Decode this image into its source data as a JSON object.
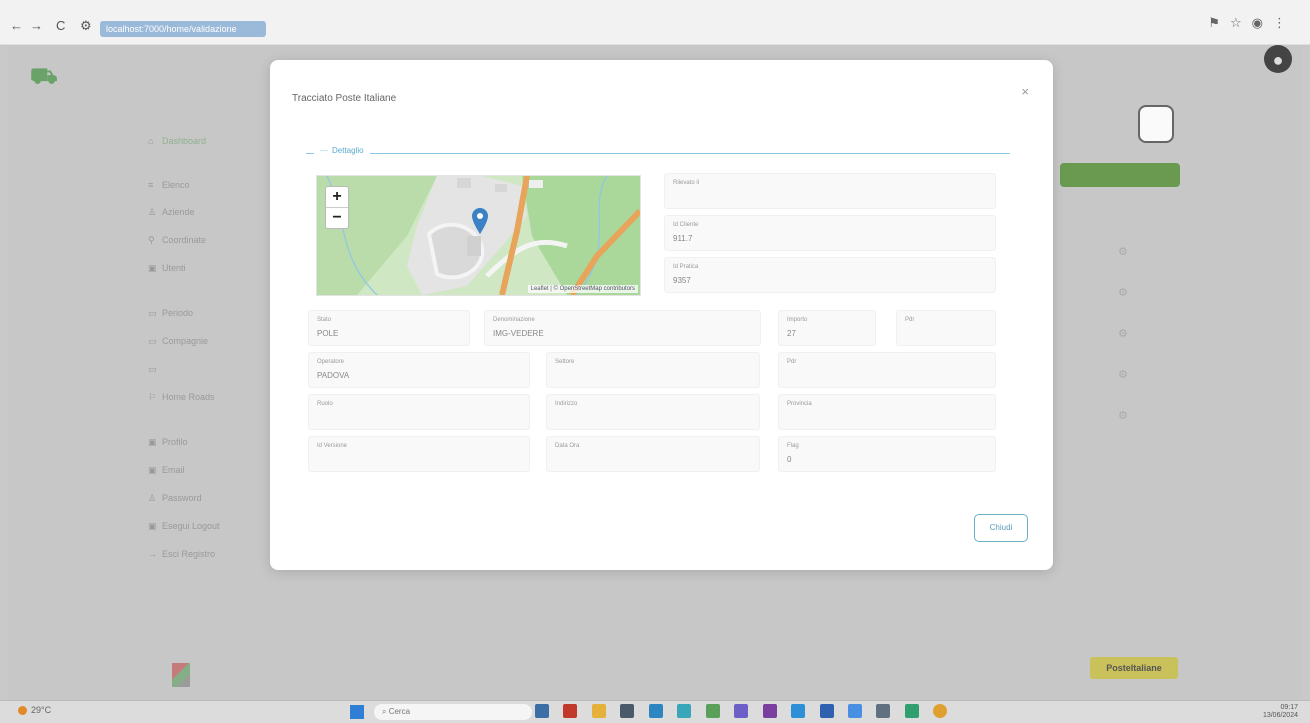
{
  "browser": {
    "url": "localhost:7000/home/validazione",
    "back": "←",
    "forward": "→",
    "reload": "C"
  },
  "app": {
    "logo_sub": "",
    "user_label": "",
    "green_button": "",
    "poste_button": "PosteItaliane",
    "sidebar": {
      "sections": [
        {
          "title": "",
          "items": [
            {
              "icon": "⌂",
              "label": "Dashboard"
            }
          ]
        },
        {
          "title": "",
          "items": [
            {
              "icon": "≡",
              "label": "Elenco"
            },
            {
              "icon": "♙",
              "label": "Aziende"
            },
            {
              "icon": "⚲",
              "label": "Coordinate"
            },
            {
              "icon": "▣",
              "label": "Utenti"
            }
          ]
        },
        {
          "title": "",
          "items": [
            {
              "icon": "▭",
              "label": "Periodo"
            },
            {
              "icon": "▭",
              "label": "Compagnie"
            },
            {
              "icon": "▭",
              "label": ""
            },
            {
              "icon": "⚐",
              "label": "Home Roads"
            }
          ]
        },
        {
          "title": "",
          "items": [
            {
              "icon": "▣",
              "label": "Profilo"
            },
            {
              "icon": "▣",
              "label": "Email"
            },
            {
              "icon": "♙",
              "label": "Password"
            },
            {
              "icon": "▣",
              "label": "Esegui Logout"
            },
            {
              "icon": "→",
              "label": "Esci Registro"
            }
          ]
        }
      ]
    }
  },
  "modal": {
    "title": "Tracciato Poste Italiane",
    "close_glyph": "×",
    "legend": "Dettaglio",
    "map": {
      "zoom_in": "+",
      "zoom_out": "−",
      "attribution": "Leaflet | © OpenStreetMap contributors"
    },
    "fields": [
      {
        "id": "rilevato",
        "label": "Rilevato il",
        "value": ""
      },
      {
        "id": "lat",
        "label": "Id Cliente",
        "value": "911.7"
      },
      {
        "id": "lon",
        "label": "Id Pratica",
        "value": "9357"
      },
      {
        "id": "nome",
        "label": "Stato",
        "value": "POLE"
      },
      {
        "id": "denominazione",
        "label": "Denominazione",
        "value": "IMG-VEDERE"
      },
      {
        "id": "importo",
        "label": "Importo",
        "value": "27"
      },
      {
        "id": "pdr",
        "label": "Pdr",
        "value": ""
      },
      {
        "id": "operatore",
        "label": "Operatore",
        "value": "PADOVA"
      },
      {
        "id": "stato2",
        "label": "Settore",
        "value": ""
      },
      {
        "id": "pdv",
        "label": "Pdr",
        "value": ""
      },
      {
        "id": "cod",
        "label": "Ruolo",
        "value": ""
      },
      {
        "id": "indirizzo",
        "label": "Indirizzo",
        "value": ""
      },
      {
        "id": "provincia",
        "label": "Provincia",
        "value": ""
      },
      {
        "id": "note",
        "label": "Id Versione",
        "value": ""
      },
      {
        "id": "data",
        "label": "Data Ora",
        "value": ""
      },
      {
        "id": "flag",
        "label": "Flag",
        "value": "0"
      }
    ],
    "close_button": "Chiudi"
  },
  "taskbar": {
    "weather": "29°C",
    "search_placeholder": "Cerca",
    "time": "09:17",
    "date": "13/06/2024"
  },
  "colors": {
    "accent": "#5aaad0",
    "green": "#6a9a50",
    "poste_yellow": "#c9c25a"
  }
}
